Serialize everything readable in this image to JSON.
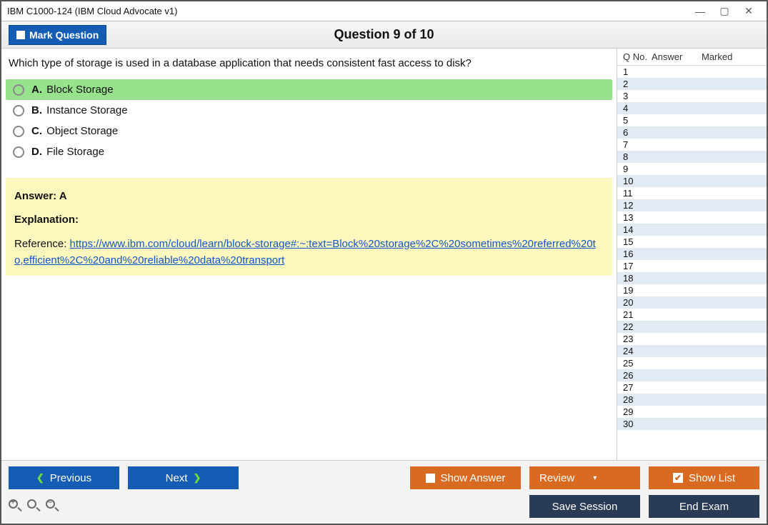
{
  "window_title": "IBM C1000-124 (IBM Cloud Advocate v1)",
  "topbar": {
    "mark_label": "Mark Question",
    "question_title": "Question 9 of 10"
  },
  "question": {
    "text": "Which type of storage is used in a database application that needs consistent fast access to disk?",
    "options": [
      {
        "letter": "A.",
        "text": "Block Storage",
        "correct": true
      },
      {
        "letter": "B.",
        "text": "Instance Storage",
        "correct": false
      },
      {
        "letter": "C.",
        "text": "Object Storage",
        "correct": false
      },
      {
        "letter": "D.",
        "text": "File Storage",
        "correct": false
      }
    ]
  },
  "answer": {
    "label": "Answer: A",
    "explanation_label": "Explanation:",
    "ref_prefix": "Reference: ",
    "ref_link": "https://www.ibm.com/cloud/learn/block-storage#:~:text=Block%20storage%2C%20sometimes%20referred%20to,efficient%2C%20and%20reliable%20data%20transport"
  },
  "sidebar": {
    "h1": "Q No.",
    "h2": "Answer",
    "h3": "Marked",
    "count": 30
  },
  "footer": {
    "prev": "Previous",
    "next": "Next",
    "show": "Show Answer",
    "review": "Review",
    "list": "Show List",
    "save": "Save Session",
    "end": "End Exam"
  }
}
